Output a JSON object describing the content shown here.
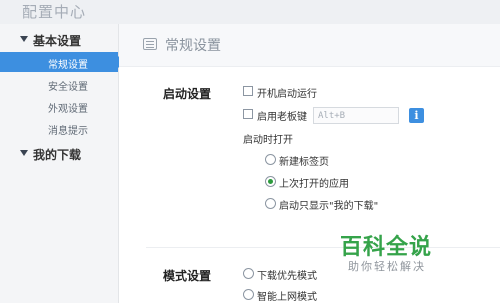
{
  "app": {
    "title": "配置中心"
  },
  "sidebar": {
    "groups": [
      {
        "label": "基本设置",
        "items": [
          {
            "label": "常规设置",
            "active": true
          },
          {
            "label": "安全设置"
          },
          {
            "label": "外观设置"
          },
          {
            "label": "消息提示"
          }
        ]
      },
      {
        "label": "我的下载",
        "items": []
      }
    ]
  },
  "main": {
    "header": {
      "title": "常规设置",
      "icon": "list-icon"
    },
    "startup": {
      "title": "启动设置",
      "autostart_label": "开机启动运行",
      "bosskey_label": "启用老板键",
      "bosskey_value": "Alt+B",
      "info_glyph": "i",
      "open_on_start_label": "启动时打开",
      "options": [
        {
          "label": "新建标签页",
          "checked": false
        },
        {
          "label": "上次打开的应用",
          "checked": true
        },
        {
          "label": "启动只显示\"我的下载\"",
          "checked": false
        }
      ]
    },
    "mode": {
      "title": "模式设置",
      "options": [
        {
          "label": "下载优先模式",
          "checked": false
        },
        {
          "label": "智能上网模式",
          "checked": false
        }
      ]
    }
  },
  "watermark": {
    "main": "百科全说",
    "sub": "助你轻松解决"
  },
  "colors": {
    "accent": "#3d8fe0",
    "radio_checked": "#2c9a3c",
    "watermark": "#35a34a"
  }
}
